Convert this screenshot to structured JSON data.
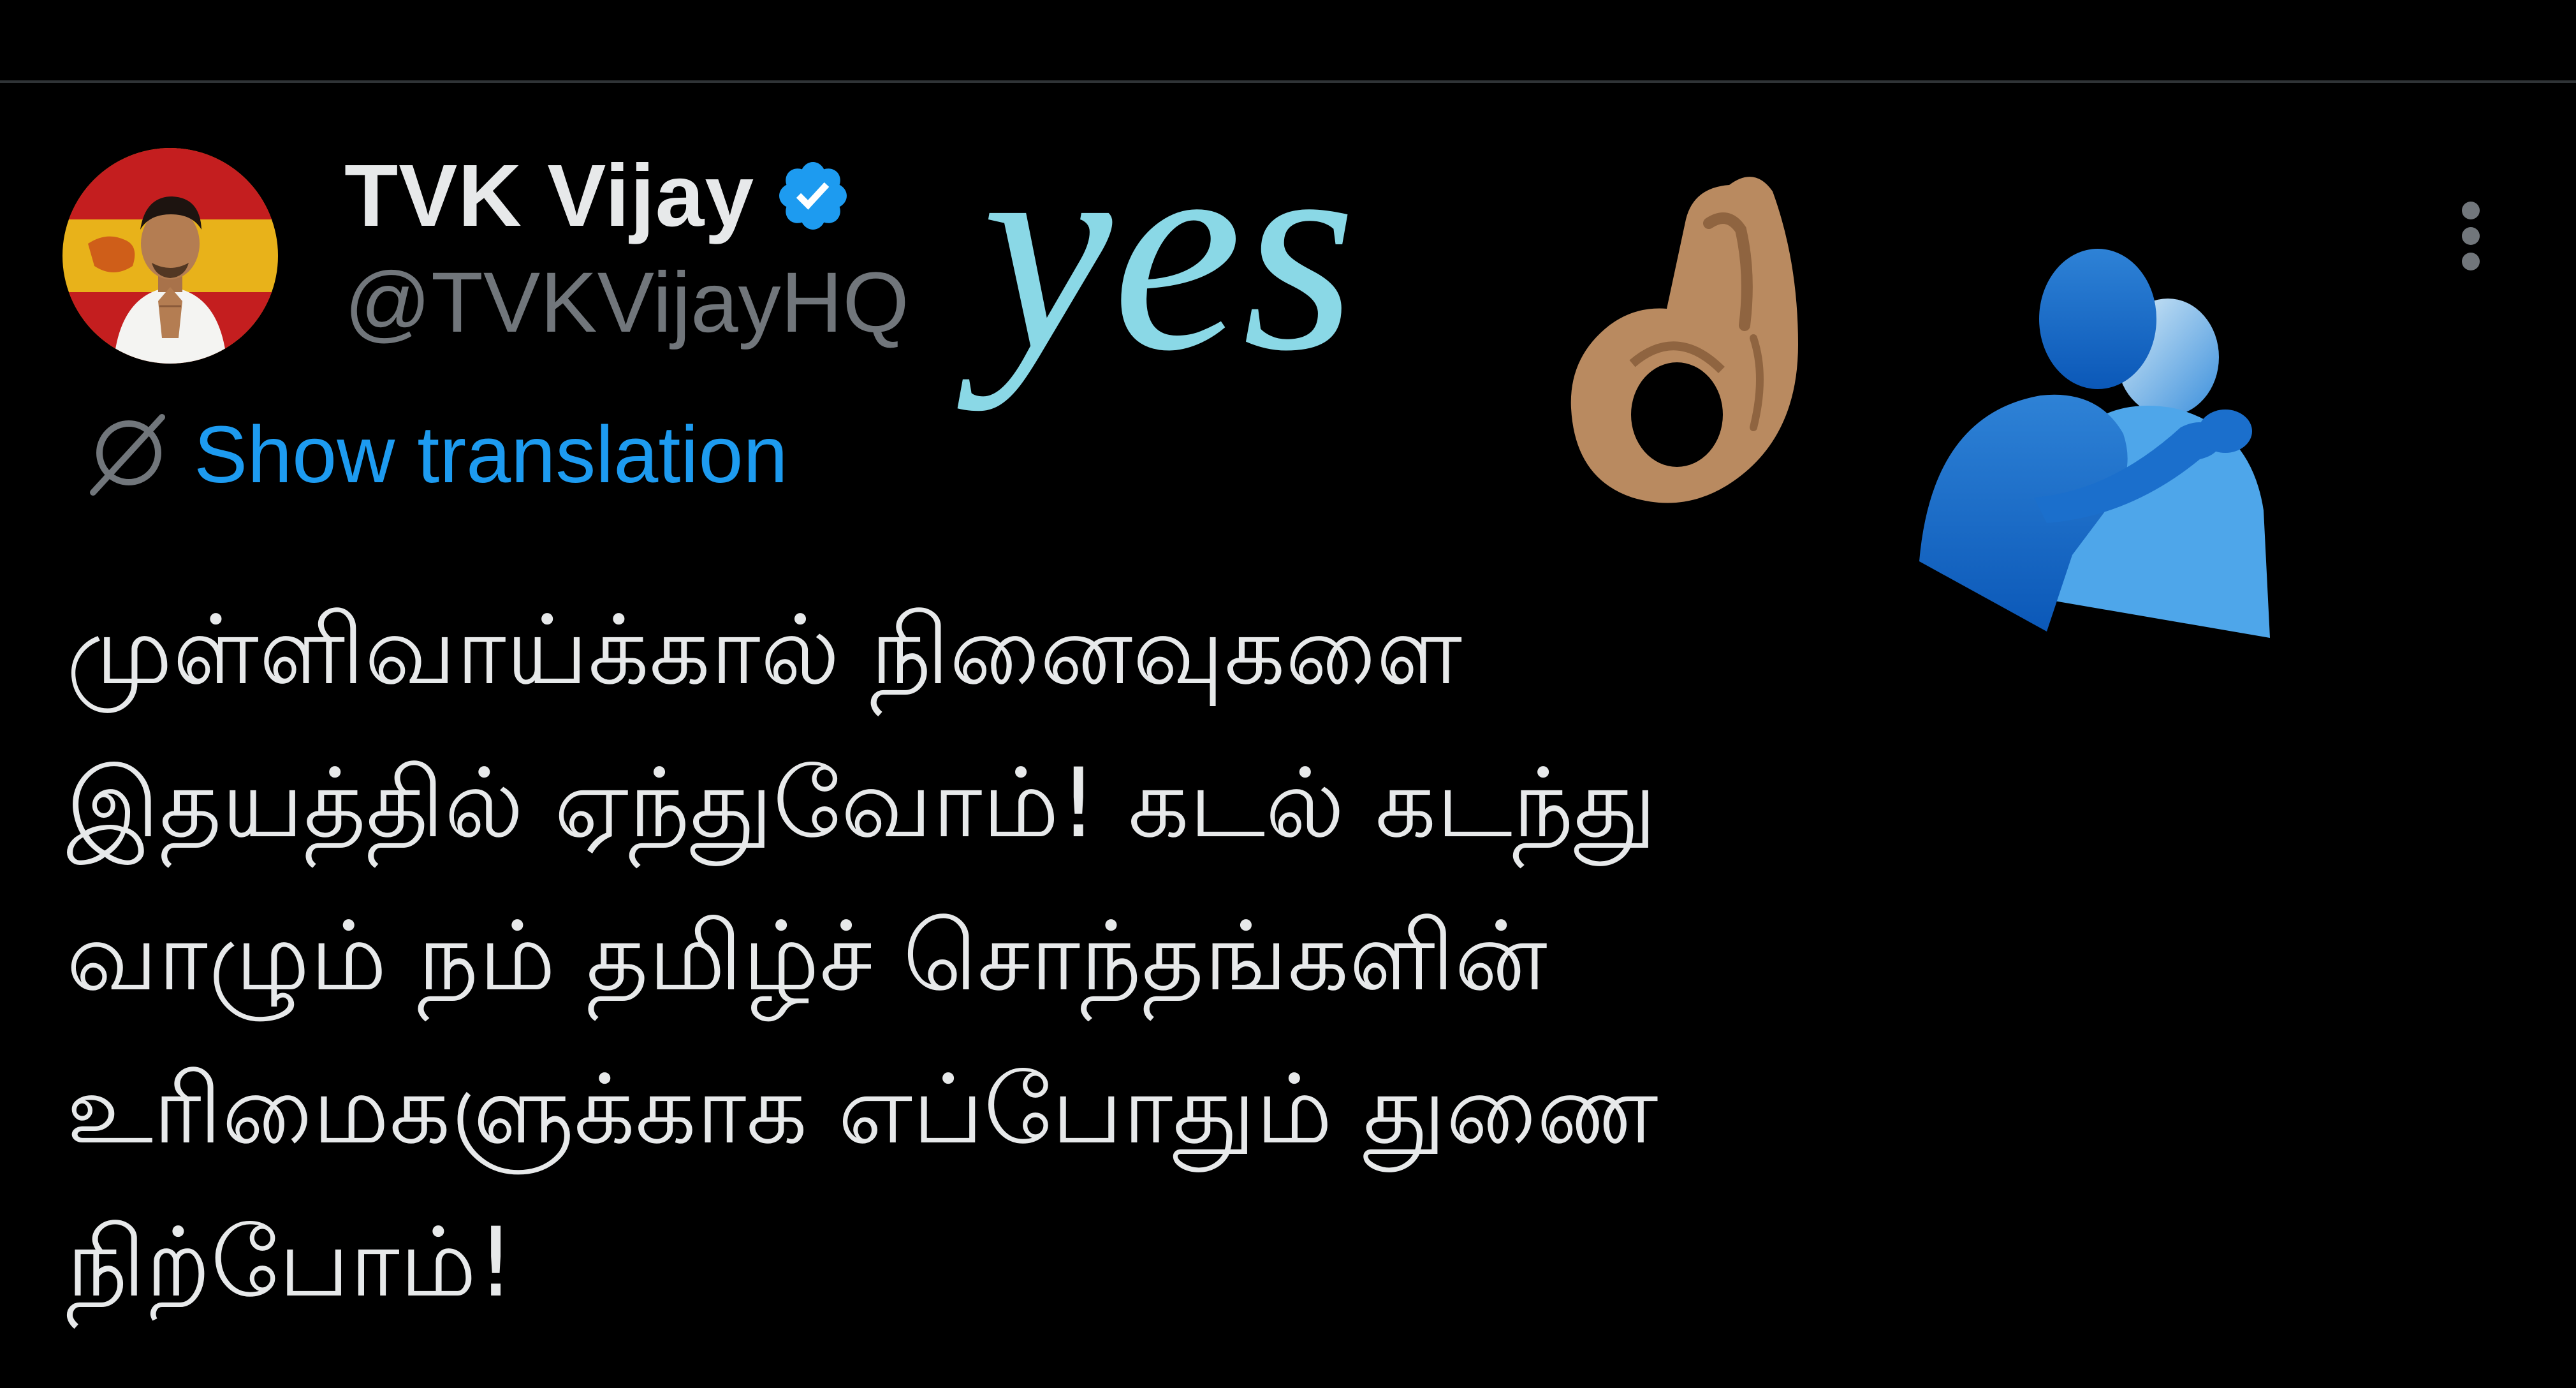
{
  "tweet": {
    "author": {
      "display_name": "TVK Vijay",
      "handle": "@TVKVijayHQ",
      "avatar_icon": "profile-photo",
      "verified_icon": "verified-badge-icon"
    },
    "translate": {
      "label": "Show translation",
      "icon": "translate-globe-icon"
    },
    "more_icon": "more-vertical-icon",
    "text": "முள்ளிவாய்க்கால் நினைவுகளை\nஇதயத்தில் ஏந்துவோம்! கடல் கடந்து\nவாழும் நம் தமிழ்ச் சொந்தங்களின்\nஉரிமைகளுக்காக எப்போதும் துணை\nநிற்போம்!"
  },
  "overlay": {
    "yes_text": "yes",
    "ok_emoji": "ok-hand-icon",
    "hug_emoji": "people-hugging-icon"
  },
  "colors": {
    "background": "#000000",
    "primary_text": "#e7e9ea",
    "secondary_text": "#71767b",
    "link_blue": "#1d9bf0",
    "divider": "#2f3336",
    "yes_sticker": "#8ad8e6"
  }
}
